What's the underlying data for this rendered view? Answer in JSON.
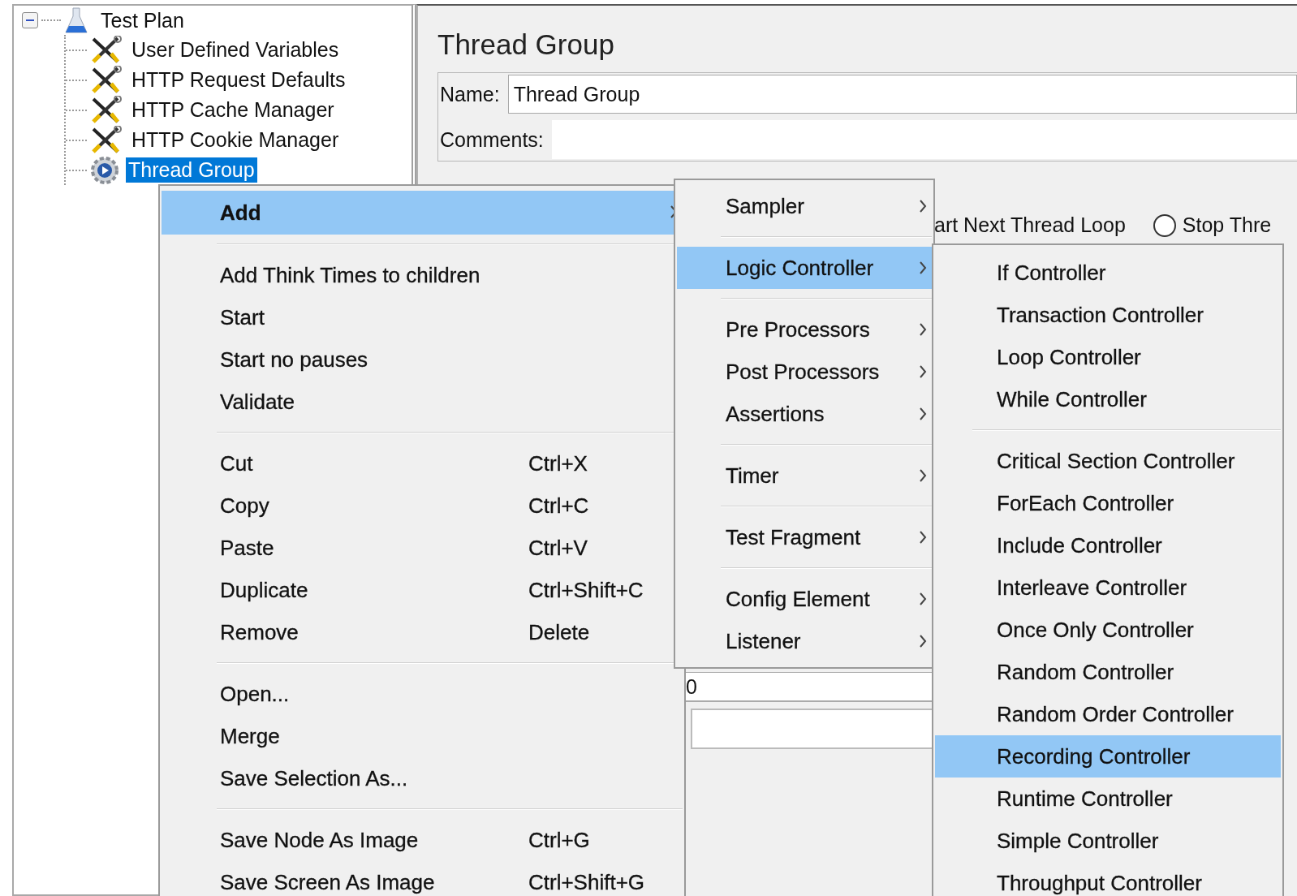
{
  "tree": {
    "label": "Test Plan",
    "expanded": true,
    "children": [
      {
        "label": "User Defined Variables",
        "kind": "config",
        "selected": false
      },
      {
        "label": "HTTP Request Defaults",
        "kind": "config",
        "selected": false
      },
      {
        "label": "HTTP Cache Manager",
        "kind": "config",
        "selected": false
      },
      {
        "label": "HTTP Cookie Manager",
        "kind": "config",
        "selected": false
      },
      {
        "label": "Thread Group",
        "kind": "thread-group",
        "selected": true
      }
    ]
  },
  "editor": {
    "title": "Thread Group",
    "name_label": "Name:",
    "name_value": "Thread Group",
    "comments_label": "Comments:",
    "partial_option": "art Next Thread Loop",
    "radio": {
      "label": "Stop Thre",
      "selected": false
    },
    "field_value": "0"
  },
  "menus": [
    {
      "items": [
        {
          "kind": "strong",
          "label": "Add",
          "has_submenu": true,
          "selected": true
        },
        {
          "kind": "separator"
        },
        {
          "kind": "item",
          "label": "Add Think Times to children",
          "has_submenu": false,
          "selected": false
        },
        {
          "kind": "item",
          "label": "Start",
          "has_submenu": false,
          "selected": false
        },
        {
          "kind": "item",
          "label": "Start no pauses",
          "has_submenu": false,
          "selected": false
        },
        {
          "kind": "item",
          "label": "Validate",
          "has_submenu": false,
          "selected": false
        },
        {
          "kind": "separator"
        },
        {
          "kind": "item",
          "label": "Cut",
          "shortcut": "Ctrl+X",
          "has_submenu": false,
          "selected": false
        },
        {
          "kind": "item",
          "label": "Copy",
          "shortcut": "Ctrl+C",
          "has_submenu": false,
          "selected": false
        },
        {
          "kind": "item",
          "label": "Paste",
          "shortcut": "Ctrl+V",
          "has_submenu": false,
          "selected": false
        },
        {
          "kind": "item",
          "label": "Duplicate",
          "shortcut": "Ctrl+Shift+C",
          "has_submenu": false,
          "selected": false
        },
        {
          "kind": "item",
          "label": "Remove",
          "shortcut": "Delete",
          "has_submenu": false,
          "selected": false
        },
        {
          "kind": "separator"
        },
        {
          "kind": "item",
          "label": "Open...",
          "has_submenu": false,
          "selected": false
        },
        {
          "kind": "item",
          "label": "Merge",
          "has_submenu": false,
          "selected": false
        },
        {
          "kind": "item",
          "label": "Save Selection As...",
          "has_submenu": false,
          "selected": false
        },
        {
          "kind": "separator"
        },
        {
          "kind": "item",
          "label": "Save Node As Image",
          "shortcut": "Ctrl+G",
          "has_submenu": false,
          "selected": false
        },
        {
          "kind": "item",
          "label": "Save Screen As Image",
          "shortcut": "Ctrl+Shift+G",
          "has_submenu": false,
          "selected": false
        }
      ]
    },
    {
      "items": [
        {
          "kind": "item",
          "label": "Sampler",
          "has_submenu": true,
          "selected": false
        },
        {
          "kind": "separator"
        },
        {
          "kind": "item",
          "label": "Logic Controller",
          "has_submenu": true,
          "selected": true
        },
        {
          "kind": "separator"
        },
        {
          "kind": "item",
          "label": "Pre Processors",
          "has_submenu": true,
          "selected": false
        },
        {
          "kind": "item",
          "label": "Post Processors",
          "has_submenu": true,
          "selected": false
        },
        {
          "kind": "item",
          "label": "Assertions",
          "has_submenu": true,
          "selected": false
        },
        {
          "kind": "separator"
        },
        {
          "kind": "item",
          "label": "Timer",
          "has_submenu": true,
          "selected": false
        },
        {
          "kind": "separator"
        },
        {
          "kind": "item",
          "label": "Test Fragment",
          "has_submenu": true,
          "selected": false
        },
        {
          "kind": "separator"
        },
        {
          "kind": "item",
          "label": "Config Element",
          "has_submenu": true,
          "selected": false
        },
        {
          "kind": "item",
          "label": "Listener",
          "has_submenu": true,
          "selected": false
        }
      ]
    },
    {
      "items": [
        {
          "kind": "item",
          "label": "If Controller",
          "has_submenu": false,
          "selected": false
        },
        {
          "kind": "item",
          "label": "Transaction Controller",
          "has_submenu": false,
          "selected": false
        },
        {
          "kind": "item",
          "label": "Loop Controller",
          "has_submenu": false,
          "selected": false
        },
        {
          "kind": "item",
          "label": "While Controller",
          "has_submenu": false,
          "selected": false
        },
        {
          "kind": "separator"
        },
        {
          "kind": "item",
          "label": "Critical Section Controller",
          "has_submenu": false,
          "selected": false
        },
        {
          "kind": "item",
          "label": "ForEach Controller",
          "has_submenu": false,
          "selected": false
        },
        {
          "kind": "item",
          "label": "Include Controller",
          "has_submenu": false,
          "selected": false
        },
        {
          "kind": "item",
          "label": "Interleave Controller",
          "has_submenu": false,
          "selected": false
        },
        {
          "kind": "item",
          "label": "Once Only Controller",
          "has_submenu": false,
          "selected": false
        },
        {
          "kind": "item",
          "label": "Random Controller",
          "has_submenu": false,
          "selected": false
        },
        {
          "kind": "item",
          "label": "Random Order Controller",
          "has_submenu": false,
          "selected": false
        },
        {
          "kind": "item",
          "label": "Recording Controller",
          "has_submenu": false,
          "selected": true
        },
        {
          "kind": "item",
          "label": "Runtime Controller",
          "has_submenu": false,
          "selected": false
        },
        {
          "kind": "item",
          "label": "Simple Controller",
          "has_submenu": false,
          "selected": false
        },
        {
          "kind": "item",
          "label": "Throughput Controller",
          "has_submenu": false,
          "selected": false
        }
      ]
    }
  ]
}
